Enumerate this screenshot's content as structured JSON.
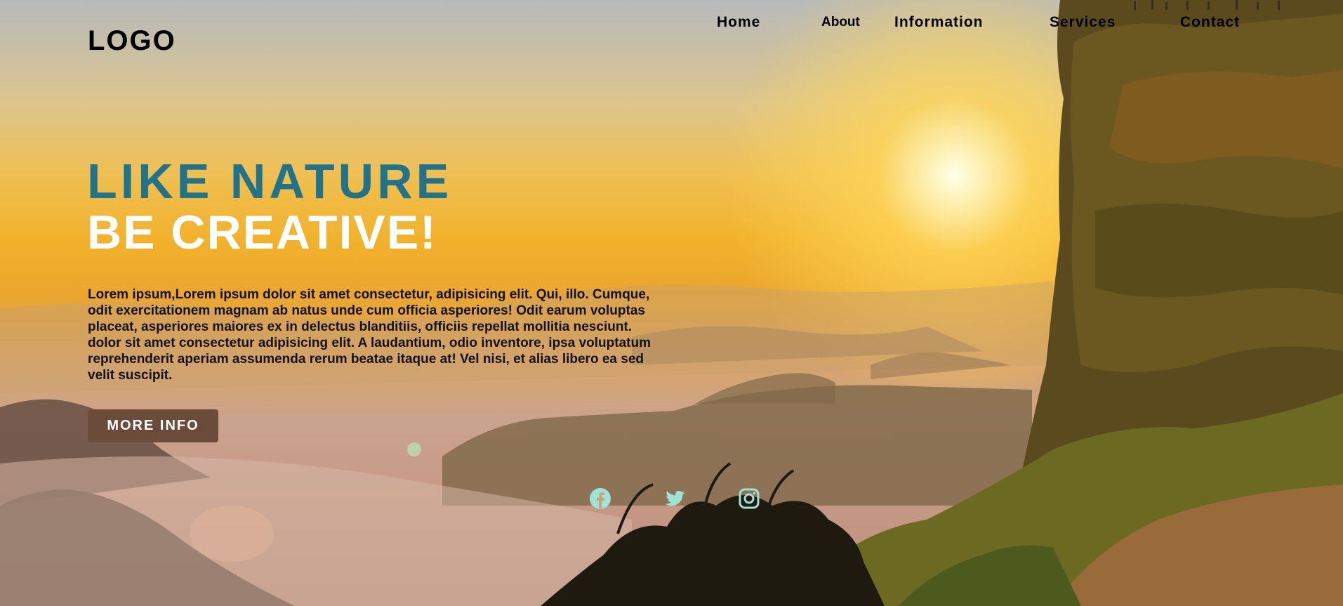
{
  "header": {
    "logo": "LOGO",
    "nav": [
      {
        "label": "Home"
      },
      {
        "label": "About"
      },
      {
        "label": "Information"
      },
      {
        "label": "Services"
      },
      {
        "label": "Contact"
      }
    ]
  },
  "hero": {
    "title_line_1": "LIKE NATURE",
    "title_line_2": "BE CREATIVE!",
    "description": "Lorem ipsum,Lorem ipsum dolor sit amet consectetur, adipisicing elit. Qui, illo. Cumque, odit exercitationem magnam ab natus unde cum officia asperiores! Odit earum voluptas placeat, asperiores maiores ex in delectus blanditiis, officiis repellat mollitia nesciunt. dolor sit amet consectetur adipisicing elit. A laudantium, odio inventore, ipsa voluptatum reprehenderit aperiam assumenda rerum beatae itaque at! Vel nisi, et alias libero ea sed velit suscipit.",
    "cta_label": "MORE INFO"
  },
  "social": [
    {
      "icon": "facebook-icon"
    },
    {
      "icon": "twitter-icon"
    },
    {
      "icon": "instagram-icon"
    }
  ],
  "colors": {
    "title_accent": "#22728a",
    "title_secondary": "#ffffff",
    "button_bg": "#6b4b39",
    "social_icon": "#9fe3d6"
  }
}
